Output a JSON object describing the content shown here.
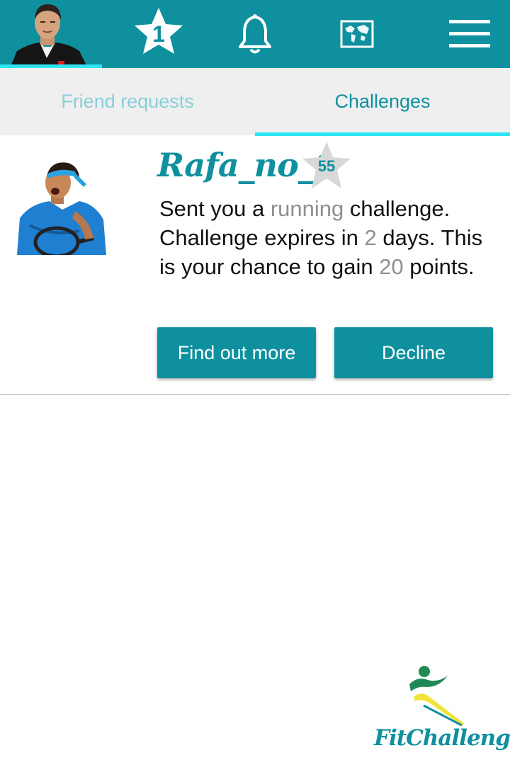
{
  "header": {
    "icons": [
      "profile-avatar",
      "star-icon",
      "bell-icon",
      "world-map-icon",
      "hamburger-menu-icon"
    ],
    "star_count": "1"
  },
  "tabs": [
    {
      "label": "Friend requests",
      "active": false
    },
    {
      "label": "Challenges",
      "active": true
    }
  ],
  "challenge": {
    "sender_name": "Rafa_no_1",
    "sender_level": "55",
    "msg_part1": "Sent you a ",
    "activity": "running",
    "msg_part2": " challenge. Challenge expires in ",
    "days": "2",
    "msg_part3": " days. This is your chance to gain ",
    "points": "20",
    "msg_part4": " points.",
    "find_out_more_label": "Find out more",
    "decline_label": "Decline"
  },
  "logo": {
    "text": "FitChallenger"
  },
  "colors": {
    "primary": "#0f909f",
    "accent": "#2ee6f2",
    "tab_bg": "#efefef",
    "highlight_text": "#8f8f8f",
    "logo_yellow": "#f2e33a",
    "logo_green": "#1f8a55"
  }
}
